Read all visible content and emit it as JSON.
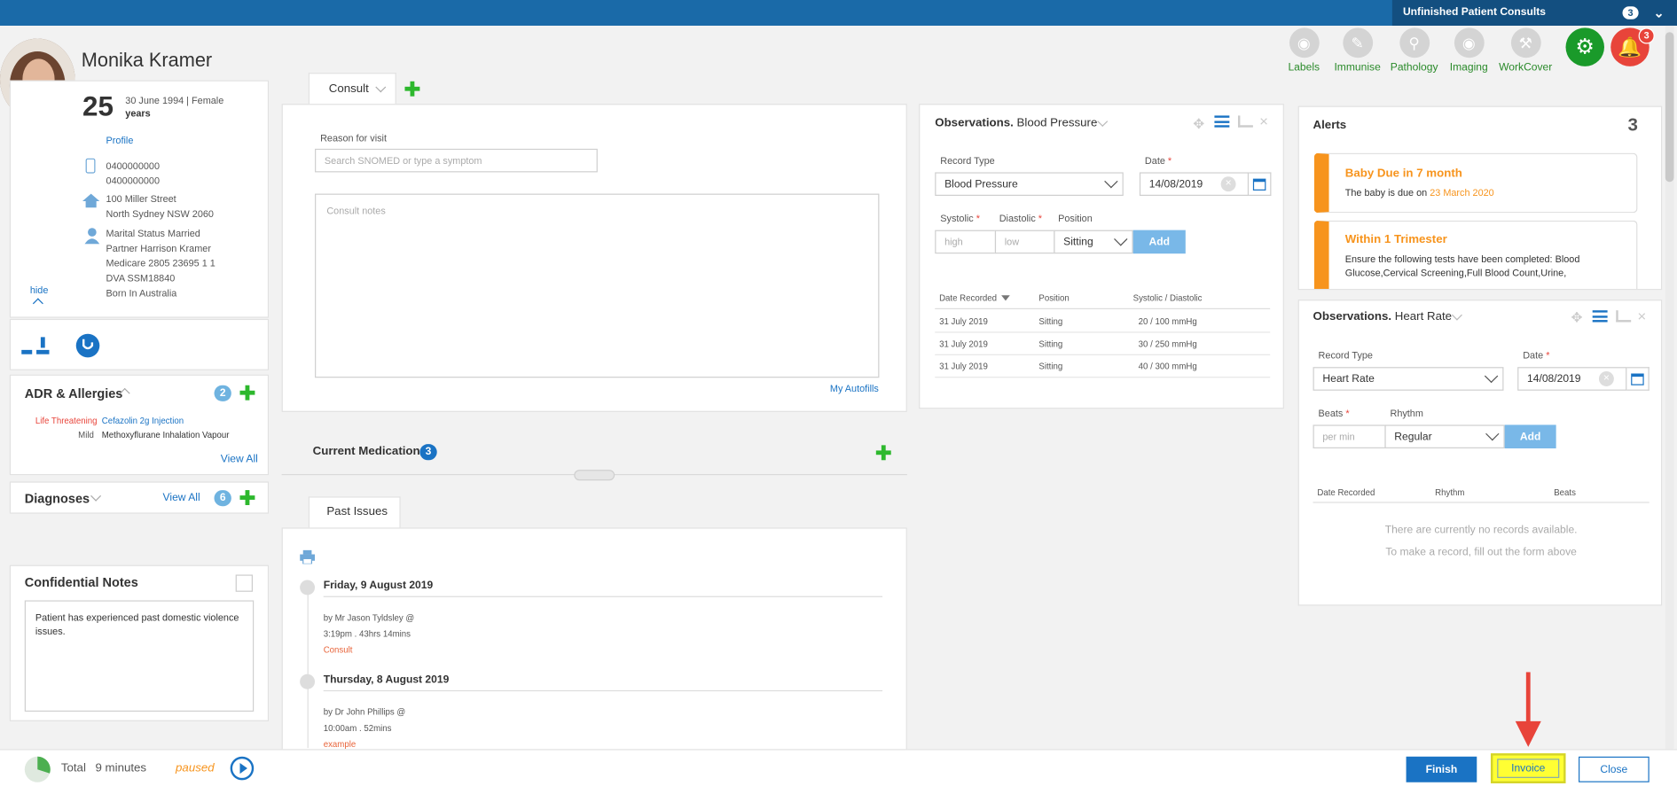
{
  "topbar": {
    "unfinished_label": "Unfinished Patient Consults",
    "unfinished_count": "3"
  },
  "patient": {
    "name": "Monika Kramer",
    "age": "25",
    "dob_gender": "30 June 1994 | Female",
    "age_unit": "years",
    "profile_link": "Profile",
    "phone1": "0400000000",
    "phone2": "0400000000",
    "address1": "100 Miller Street",
    "address2": "North Sydney NSW 2060",
    "marital": "Marital Status Married",
    "partner": "Partner Harrison Kramer",
    "medicare": "Medicare 2805 23695 1 1",
    "dva": "DVA SSM18840",
    "born": "Born In Australia",
    "hide": "hide"
  },
  "toolbar": {
    "items": [
      {
        "label": "Labels",
        "icon": "tag-icon"
      },
      {
        "label": "Immunise",
        "icon": "syringe-icon"
      },
      {
        "label": "Pathology",
        "icon": "microscope-icon"
      },
      {
        "label": "Imaging",
        "icon": "eye-icon"
      },
      {
        "label": "WorkCover",
        "icon": "hammer-icon"
      }
    ],
    "notif_count": "3"
  },
  "adr": {
    "title": "ADR & Allergies",
    "count": "2",
    "items": [
      {
        "severity": "Life Threatening",
        "name": "Cefazolin 2g Injection"
      },
      {
        "severity": "Mild",
        "name": "Methoxyflurane Inhalation Vapour"
      }
    ],
    "view_all": "View All"
  },
  "diagnoses": {
    "title": "Diagnoses",
    "view_all": "View All",
    "count": "6"
  },
  "confidential": {
    "title": "Confidential Notes",
    "text": "Patient has experienced past domestic violence issues."
  },
  "timer": {
    "total_label": "Total",
    "time": "9 minutes",
    "status": "paused",
    "progress": 0.3
  },
  "consult": {
    "tab": "Consult",
    "reason_label": "Reason for visit",
    "reason_placeholder": "Search SNOMED or type a symptom",
    "notes_placeholder": "Consult notes",
    "autofills": "My Autofills"
  },
  "medication": {
    "title": "Current Medication",
    "count": "3"
  },
  "past": {
    "tab": "Past Issues",
    "entries": [
      {
        "date": "Friday, 9 August 2019",
        "by": "by Mr Jason Tyldsley @",
        "time": "3:19pm  .  43hrs 14mins",
        "type": "Consult"
      },
      {
        "date": "Thursday, 8 August 2019",
        "by": "by Dr John Phillips @",
        "time": "10:00am  .  52mins",
        "type": "example"
      }
    ]
  },
  "bp": {
    "title_prefix": "Observations.",
    "title": "Blood Pressure",
    "record_type_label": "Record Type",
    "record_type": "Blood Pressure",
    "date_label": "Date",
    "date": "14/08/2019",
    "systolic_label": "Systolic",
    "diastolic_label": "Diastolic",
    "position_label": "Position",
    "systolic_ph": "high",
    "diastolic_ph": "low",
    "position": "Sitting",
    "add": "Add",
    "col_date": "Date Recorded",
    "col_position": "Position",
    "col_value": "Systolic / Diastolic",
    "rows": [
      [
        "31 July 2019",
        "Sitting",
        "20 / 100 mmHg"
      ],
      [
        "31 July 2019",
        "Sitting",
        "30 / 250 mmHg"
      ],
      [
        "31 July 2019",
        "Sitting",
        "40 / 300 mmHg"
      ]
    ]
  },
  "alerts": {
    "title": "Alerts",
    "count": "3",
    "items": [
      {
        "title": "Baby Due in 7 month",
        "text_pre": "The baby is due on ",
        "text_hl": "23 March 2020"
      },
      {
        "title": "Within 1 Trimester",
        "text": "Ensure the following tests have been completed: Blood Glucose,Cervical Screening,Full Blood Count,Urine,"
      }
    ]
  },
  "hr": {
    "title_prefix": "Observations.",
    "title": "Heart Rate",
    "record_type_label": "Record Type",
    "record_type": "Heart Rate",
    "date_label": "Date",
    "date": "14/08/2019",
    "beats_label": "Beats",
    "rhythm_label": "Rhythm",
    "beats_ph": "per min",
    "rhythm": "Regular",
    "add": "Add",
    "col_date": "Date Recorded",
    "col_rhythm": "Rhythm",
    "col_beats": "Beats",
    "empty1": "There are currently no records available.",
    "empty2": "To make a record, fill out the form above"
  },
  "actions": {
    "finish": "Finish",
    "invoice": "Invoice",
    "close": "Close"
  },
  "colors": {
    "brand": "#1a6aa8",
    "green": "#2db82d",
    "orange": "#f7941d",
    "red": "#e8443a",
    "highlight": "#ffff33"
  }
}
